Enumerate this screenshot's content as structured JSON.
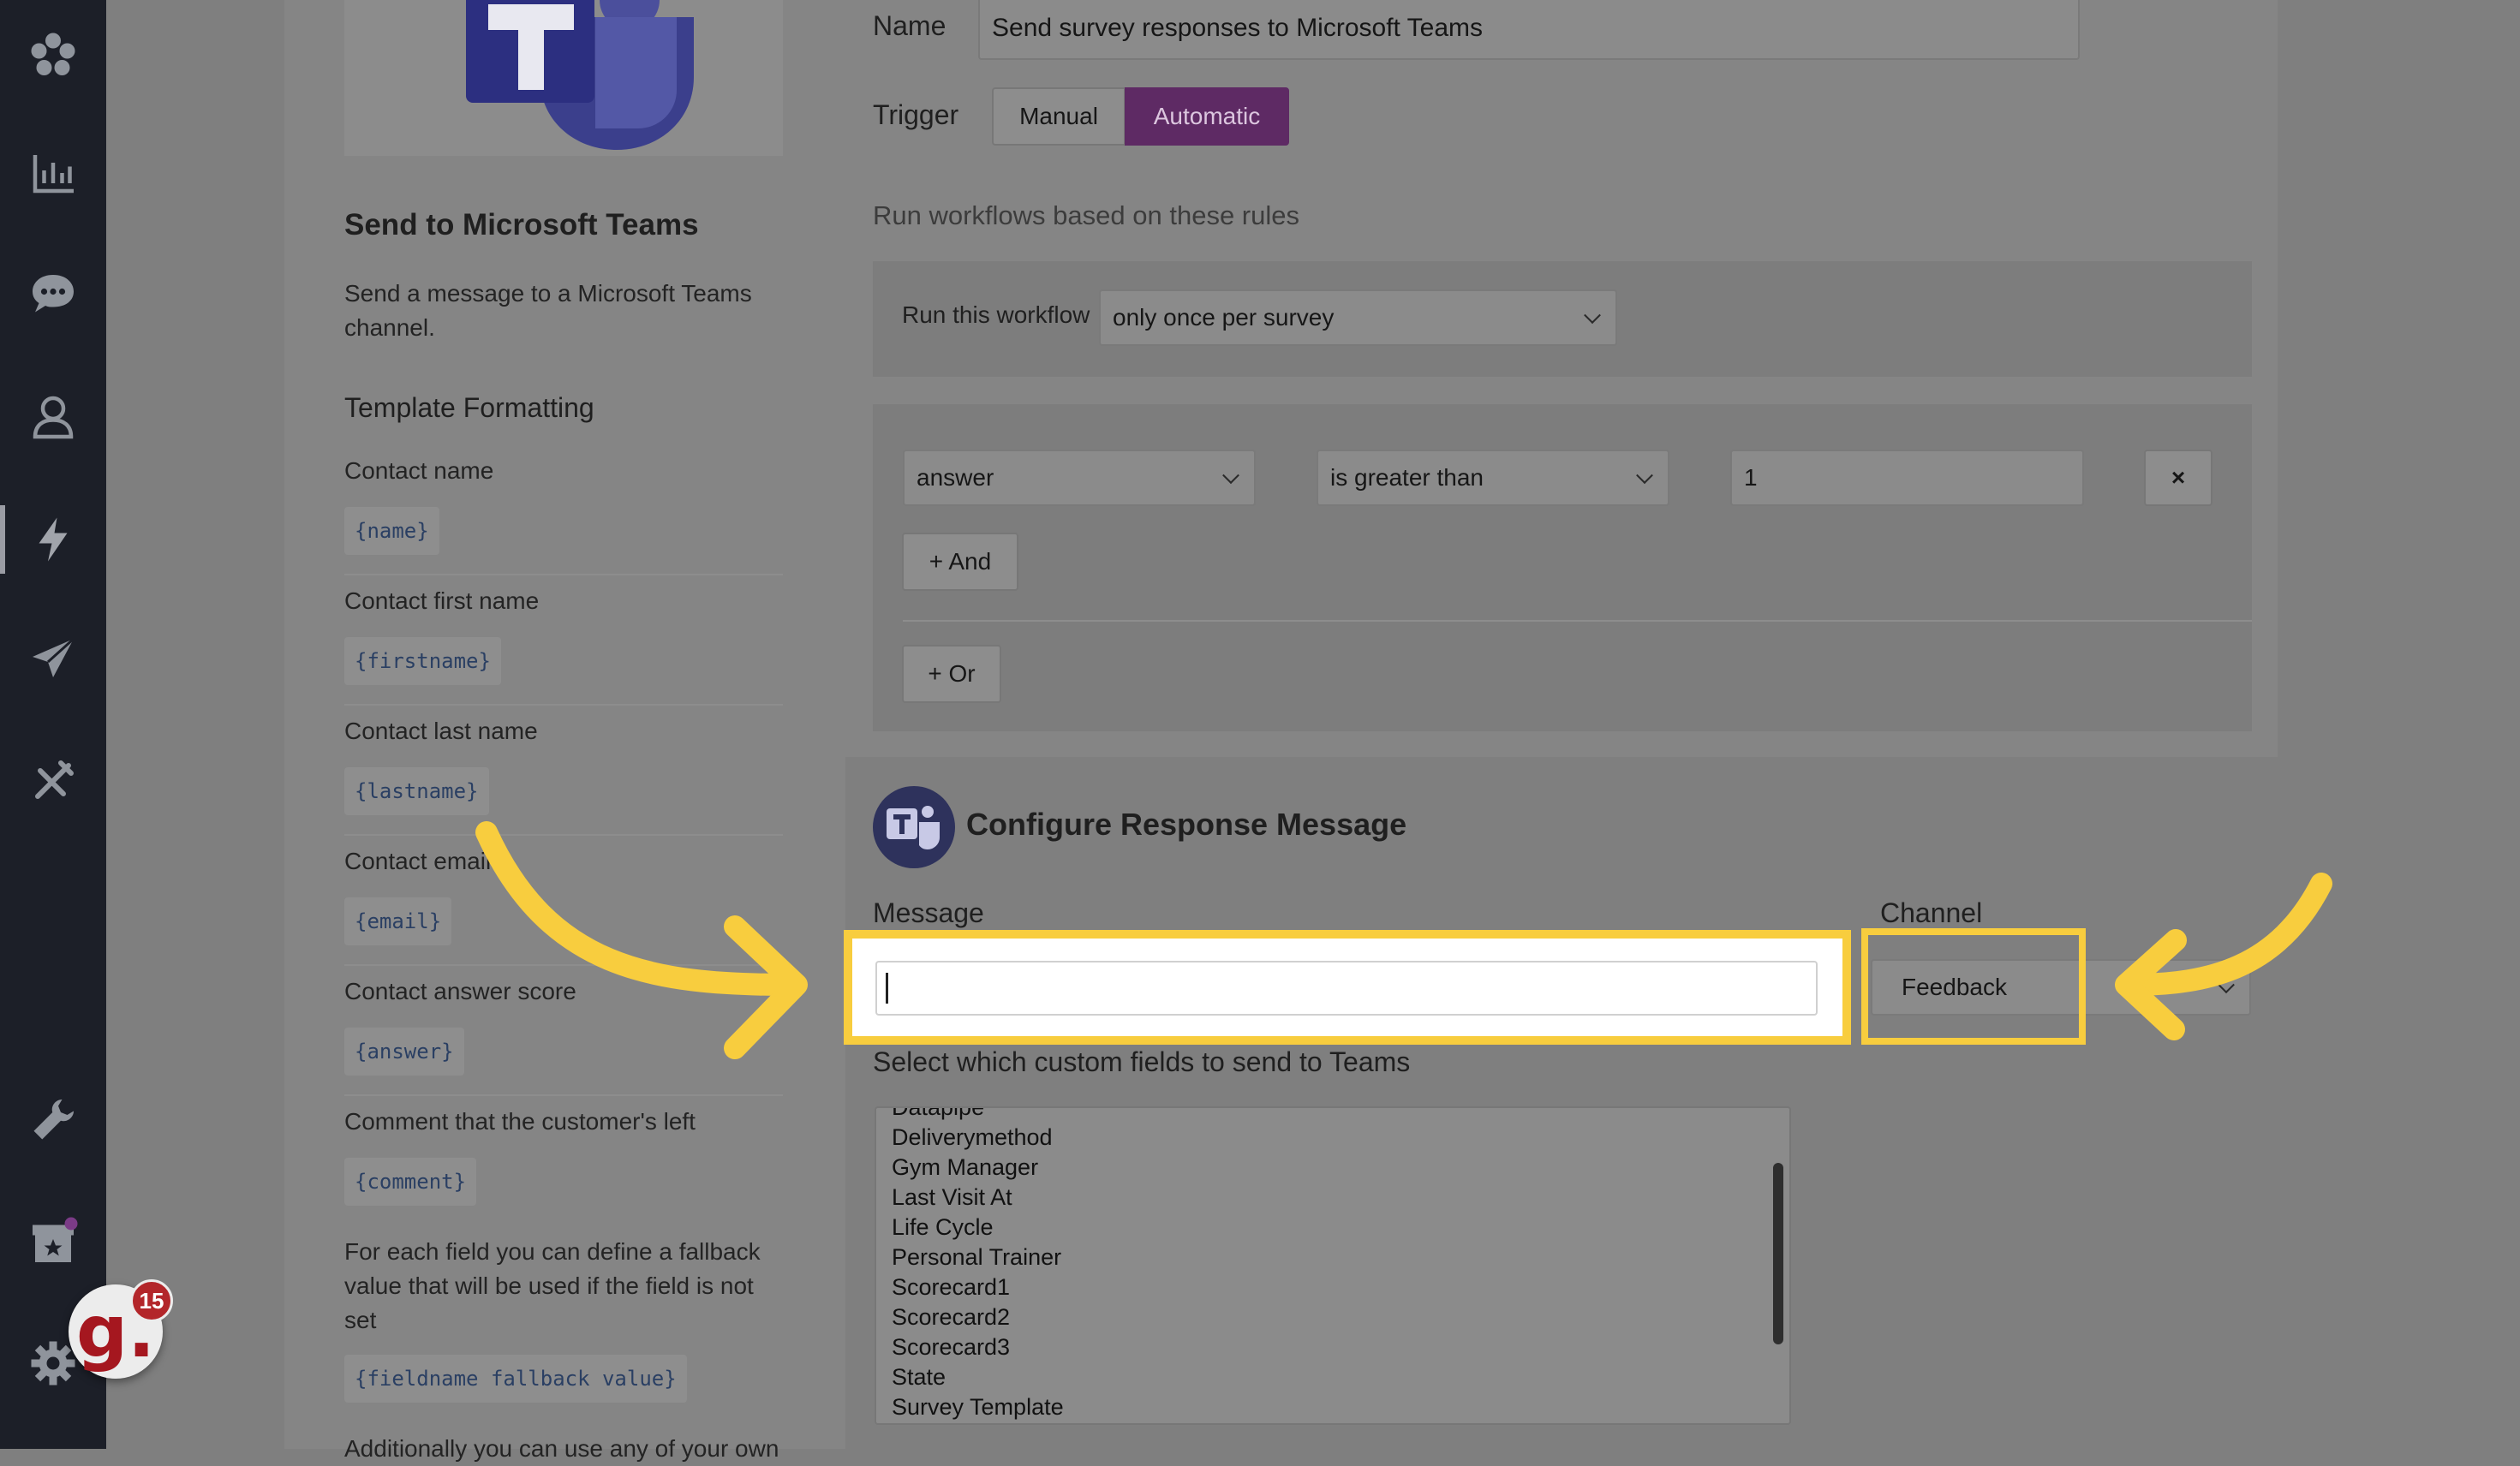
{
  "sidebar": {
    "icons": [
      "logo-icon",
      "chart-icon",
      "chat-icon",
      "user-icon",
      "bolt-icon",
      "send-icon",
      "tools-icon",
      "wrench-icon",
      "store-icon",
      "gear-icon"
    ],
    "grader_letter": "g.",
    "grader_badge": "15"
  },
  "help": {
    "title": "Send to Microsoft Teams",
    "description": "Send a message to a Microsoft Teams channel.",
    "template_heading": "Template Formatting",
    "fields": [
      {
        "label": "Contact name",
        "code": "{name}"
      },
      {
        "label": "Contact first name",
        "code": "{firstname}"
      },
      {
        "label": "Contact last name",
        "code": "{lastname}"
      },
      {
        "label": "Contact email",
        "code": "{email}"
      },
      {
        "label": "Contact answer score",
        "code": "{answer}"
      },
      {
        "label": "Comment that the customer's left",
        "code": "{comment}"
      }
    ],
    "fallback_text": "For each field you can define a fallback value that will be used if the field is not set",
    "fallback_code": "{fieldname fallback value}",
    "additional_text": "Additionally you can use any of your own"
  },
  "form": {
    "name_label": "Name",
    "name_value": "Send survey responses to Microsoft Teams",
    "trigger_label": "Trigger",
    "trigger_manual": "Manual",
    "trigger_automatic": "Automatic",
    "rules_heading": "Run workflows based on these rules",
    "run_label": "Run this workflow",
    "run_value": "only once per survey",
    "condition_field": "answer",
    "condition_operator": "is greater than",
    "condition_value": "1",
    "remove_label": "×",
    "and_label": "+ And",
    "or_label": "+ Or",
    "configure_heading": "Configure Response Message",
    "message_label": "Message",
    "message_value": "",
    "channel_label": "Channel",
    "channel_value": "Feedback",
    "custom_fields_label": "Select which custom fields to send to Teams",
    "custom_fields": [
      "Datapipe",
      "Deliverymethod",
      "Gym Manager",
      "Last Visit At",
      "Life Cycle",
      "Personal Trainer",
      "Scorecard1",
      "Scorecard2",
      "Scorecard3",
      "State",
      "Survey Template"
    ]
  },
  "colors": {
    "highlight": "#f8cd3e",
    "automatic_active": "#5e2a64",
    "sidebar": "#1c1f28"
  }
}
